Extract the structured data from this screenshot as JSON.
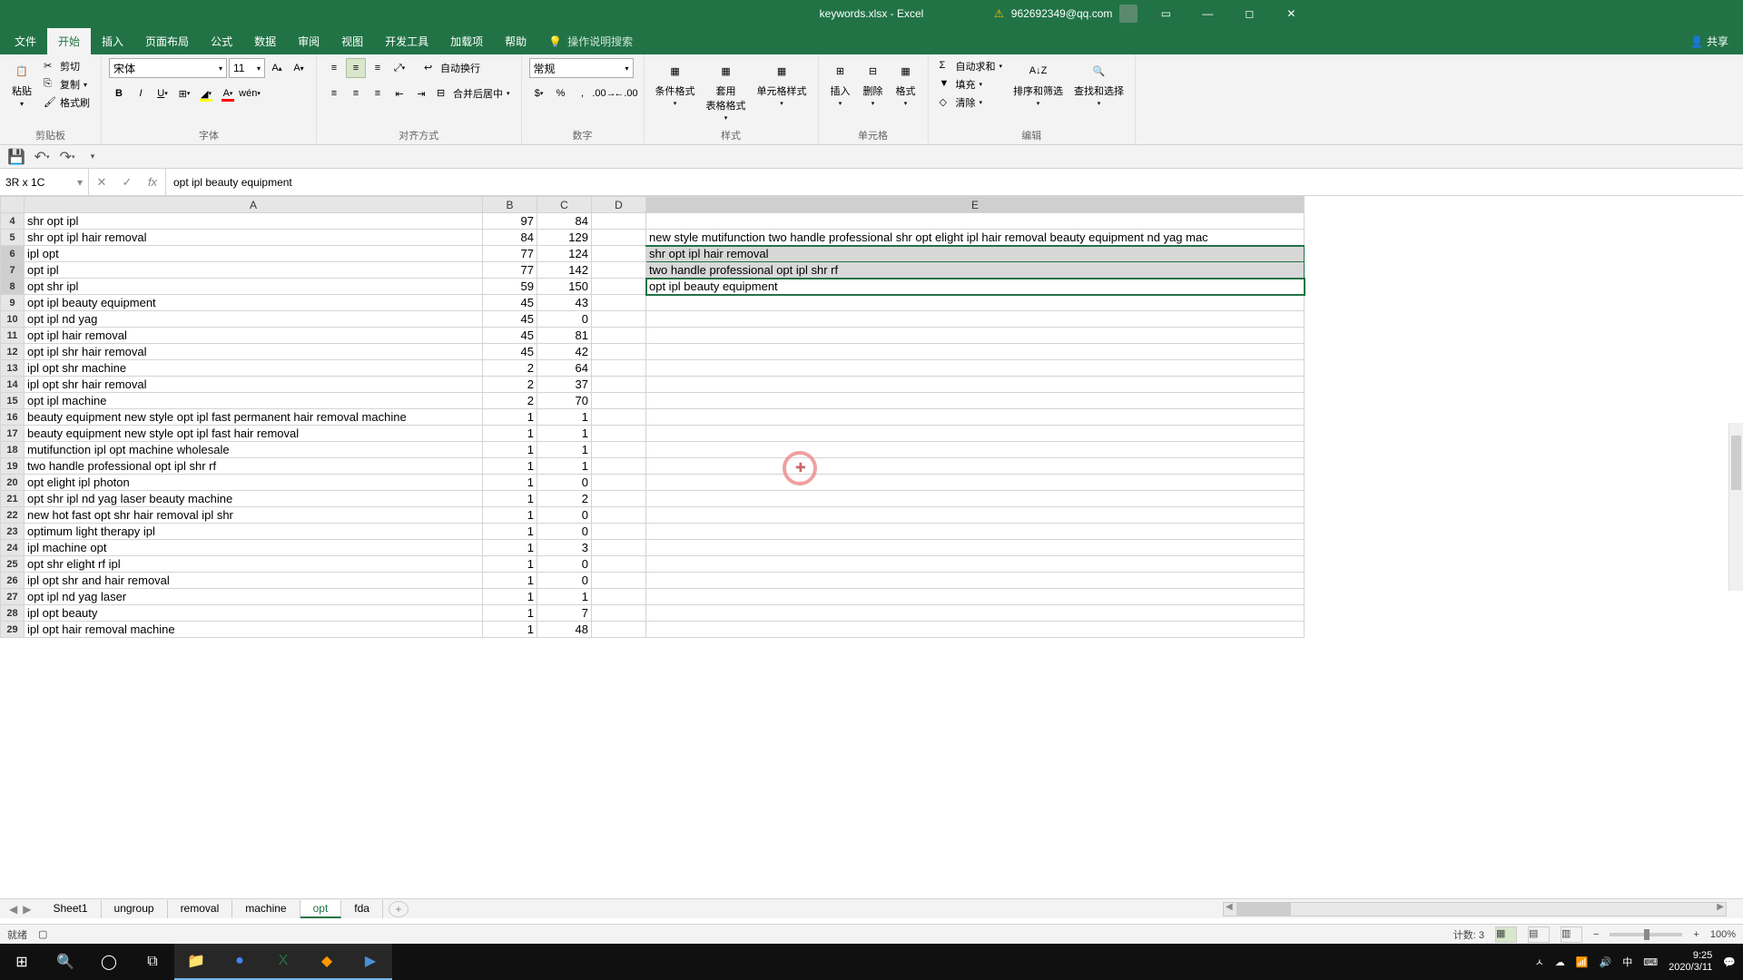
{
  "title": "keywords.xlsx - Excel",
  "user_email": "962692349@qq.com",
  "menu": {
    "file": "文件",
    "home": "开始",
    "insert": "插入",
    "layout": "页面布局",
    "formula": "公式",
    "data": "数据",
    "review": "审阅",
    "view": "视图",
    "dev": "开发工具",
    "addin": "加载项",
    "help": "帮助",
    "tell": "操作说明搜索",
    "share": "共享"
  },
  "ribbon": {
    "clipboard": {
      "paste": "粘贴",
      "cut": "剪切",
      "copy": "复制",
      "format": "格式刷",
      "label": "剪贴板"
    },
    "font": {
      "name": "宋体",
      "size": "11",
      "label": "字体"
    },
    "align": {
      "wrap": "自动换行",
      "merge": "合并后居中",
      "label": "对齐方式"
    },
    "number": {
      "format": "常规",
      "label": "数字"
    },
    "styles": {
      "cond": "条件格式",
      "table": "套用\n表格格式",
      "cell": "单元格样式",
      "label": "样式"
    },
    "cells": {
      "insert": "插入",
      "delete": "删除",
      "format": "格式",
      "label": "单元格"
    },
    "editing": {
      "sum": "自动求和",
      "fill": "填充",
      "clear": "清除",
      "sort": "排序和筛选",
      "find": "查找和选择",
      "label": "编辑"
    }
  },
  "namebox": "3R x 1C",
  "formula": "opt ipl beauty equipment",
  "columns": [
    "A",
    "B",
    "C",
    "D",
    "E"
  ],
  "rows": [
    {
      "n": 4,
      "a": "shr opt ipl",
      "b": "97",
      "c": "84",
      "e": ""
    },
    {
      "n": 5,
      "a": "shr opt ipl hair removal",
      "b": "84",
      "c": "129",
      "e": "new style mutifunction two handle professional shr opt elight ipl hair removal beauty equipment nd yag mac"
    },
    {
      "n": 6,
      "a": "ipl opt",
      "b": "77",
      "c": "124",
      "e": "shr opt ipl hair removal"
    },
    {
      "n": 7,
      "a": "opt ipl",
      "b": "77",
      "c": "142",
      "e": "two handle professional opt ipl shr rf"
    },
    {
      "n": 8,
      "a": "opt shr ipl",
      "b": "59",
      "c": "150",
      "e": "opt ipl beauty equipment"
    },
    {
      "n": 9,
      "a": "opt ipl beauty equipment",
      "b": "45",
      "c": "43",
      "e": ""
    },
    {
      "n": 10,
      "a": "opt ipl nd yag",
      "b": "45",
      "c": "0",
      "e": ""
    },
    {
      "n": 11,
      "a": "opt ipl hair removal",
      "b": "45",
      "c": "81",
      "e": ""
    },
    {
      "n": 12,
      "a": "opt ipl shr hair removal",
      "b": "45",
      "c": "42",
      "e": ""
    },
    {
      "n": 13,
      "a": "ipl opt shr machine",
      "b": "2",
      "c": "64",
      "e": ""
    },
    {
      "n": 14,
      "a": "ipl opt shr hair removal",
      "b": "2",
      "c": "37",
      "e": ""
    },
    {
      "n": 15,
      "a": "opt ipl machine",
      "b": "2",
      "c": "70",
      "e": ""
    },
    {
      "n": 16,
      "a": "beauty equipment new style opt ipl fast permanent hair removal machine",
      "b": "1",
      "c": "1",
      "e": ""
    },
    {
      "n": 17,
      "a": "beauty equipment new style opt ipl fast hair removal",
      "b": "1",
      "c": "1",
      "e": ""
    },
    {
      "n": 18,
      "a": "mutifunction ipl opt machine wholesale",
      "b": "1",
      "c": "1",
      "e": ""
    },
    {
      "n": 19,
      "a": "two handle professional opt ipl shr rf",
      "b": "1",
      "c": "1",
      "e": ""
    },
    {
      "n": 20,
      "a": "opt elight ipl photon",
      "b": "1",
      "c": "0",
      "e": ""
    },
    {
      "n": 21,
      "a": "opt shr ipl nd yag laser beauty machine",
      "b": "1",
      "c": "2",
      "e": ""
    },
    {
      "n": 22,
      "a": "new hot fast opt shr hair removal ipl shr",
      "b": "1",
      "c": "0",
      "e": ""
    },
    {
      "n": 23,
      "a": "optimum light  therapy ipl",
      "b": "1",
      "c": "0",
      "e": ""
    },
    {
      "n": 24,
      "a": "ipl machine opt",
      "b": "1",
      "c": "3",
      "e": ""
    },
    {
      "n": 25,
      "a": "opt shr elight rf ipl",
      "b": "1",
      "c": "0",
      "e": ""
    },
    {
      "n": 26,
      "a": "ipl opt shr and hair removal",
      "b": "1",
      "c": "0",
      "e": ""
    },
    {
      "n": 27,
      "a": "opt ipl nd yag laser",
      "b": "1",
      "c": "1",
      "e": ""
    },
    {
      "n": 28,
      "a": "ipl opt beauty",
      "b": "1",
      "c": "7",
      "e": ""
    },
    {
      "n": 29,
      "a": "ipl opt hair removal machine",
      "b": "1",
      "c": "48",
      "e": ""
    }
  ],
  "sheets": [
    "Sheet1",
    "ungroup",
    "removal",
    "machine",
    "opt",
    "fda"
  ],
  "active_sheet": "opt",
  "status": {
    "ready": "就绪",
    "count_label": "计数:",
    "count": "3",
    "zoom": "100%"
  },
  "clock": {
    "time": "9:25",
    "date": "2020/3/11"
  },
  "ime": "中"
}
